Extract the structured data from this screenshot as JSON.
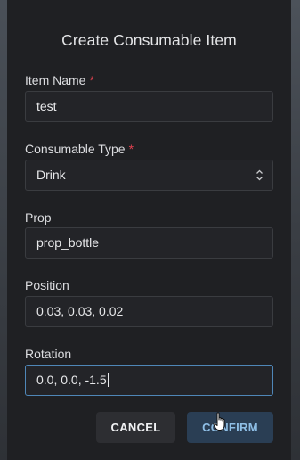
{
  "dialog": {
    "title": "Create Consumable Item"
  },
  "fields": {
    "item_name": {
      "label": "Item Name",
      "required_mark": "*",
      "value": "test"
    },
    "consumable_type": {
      "label": "Consumable Type",
      "required_mark": "*",
      "value": "Drink"
    },
    "prop": {
      "label": "Prop",
      "value": "prop_bottle"
    },
    "position": {
      "label": "Position",
      "value": "0.03, 0.03, 0.02"
    },
    "rotation": {
      "label": "Rotation",
      "value": "0.0, 0.0, -1.5"
    }
  },
  "buttons": {
    "cancel": "CANCEL",
    "confirm": "CONFIRM"
  },
  "colors": {
    "accent": "#4f87b8",
    "required": "#e0414f",
    "dialog_bg": "#1f2023"
  },
  "icons": {
    "select": "chevron-up-down-icon",
    "pointer": "hand-pointer-icon"
  }
}
